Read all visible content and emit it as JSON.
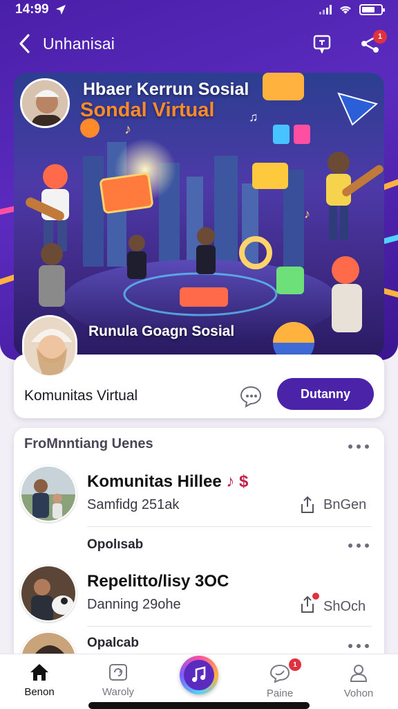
{
  "status_bar": {
    "time": "14:99"
  },
  "nav": {
    "title": "Unhanisai",
    "share_badge": "1"
  },
  "hero": {
    "title_line1": "Hbaer Kerrun Sosial",
    "title_line2": "Sondal Virtual",
    "caption": "Runula Goagn Sosial"
  },
  "community": {
    "name": "Komunitas Virtual",
    "join_label": "Dutanny"
  },
  "feed": {
    "section_title": "FroMnntiang Uenes",
    "items": [
      {
        "title": "Komunitas Hillee",
        "title_suffix": "♪ $",
        "subtitle": "Samfidg 251ak",
        "action": "BnGen"
      },
      {
        "label": "Opolısab",
        "title": "Repelitto/lisy 3OC",
        "subtitle": "Danning 29ohe",
        "action": "ShOch"
      },
      {
        "label": "Opalcab"
      }
    ]
  },
  "tabbar": {
    "tabs": [
      {
        "label": "Benon",
        "icon": "home-icon"
      },
      {
        "label": "Waroly",
        "icon": "gallery-icon"
      },
      {
        "label": "Paine",
        "icon": "chat-icon",
        "badge": "1"
      },
      {
        "label": "Vohon",
        "icon": "profile-icon"
      }
    ],
    "center_icon": "music-icon"
  },
  "colors": {
    "primary": "#4b23a8",
    "header": "#5b2bbf",
    "badge": "#e0323e"
  }
}
